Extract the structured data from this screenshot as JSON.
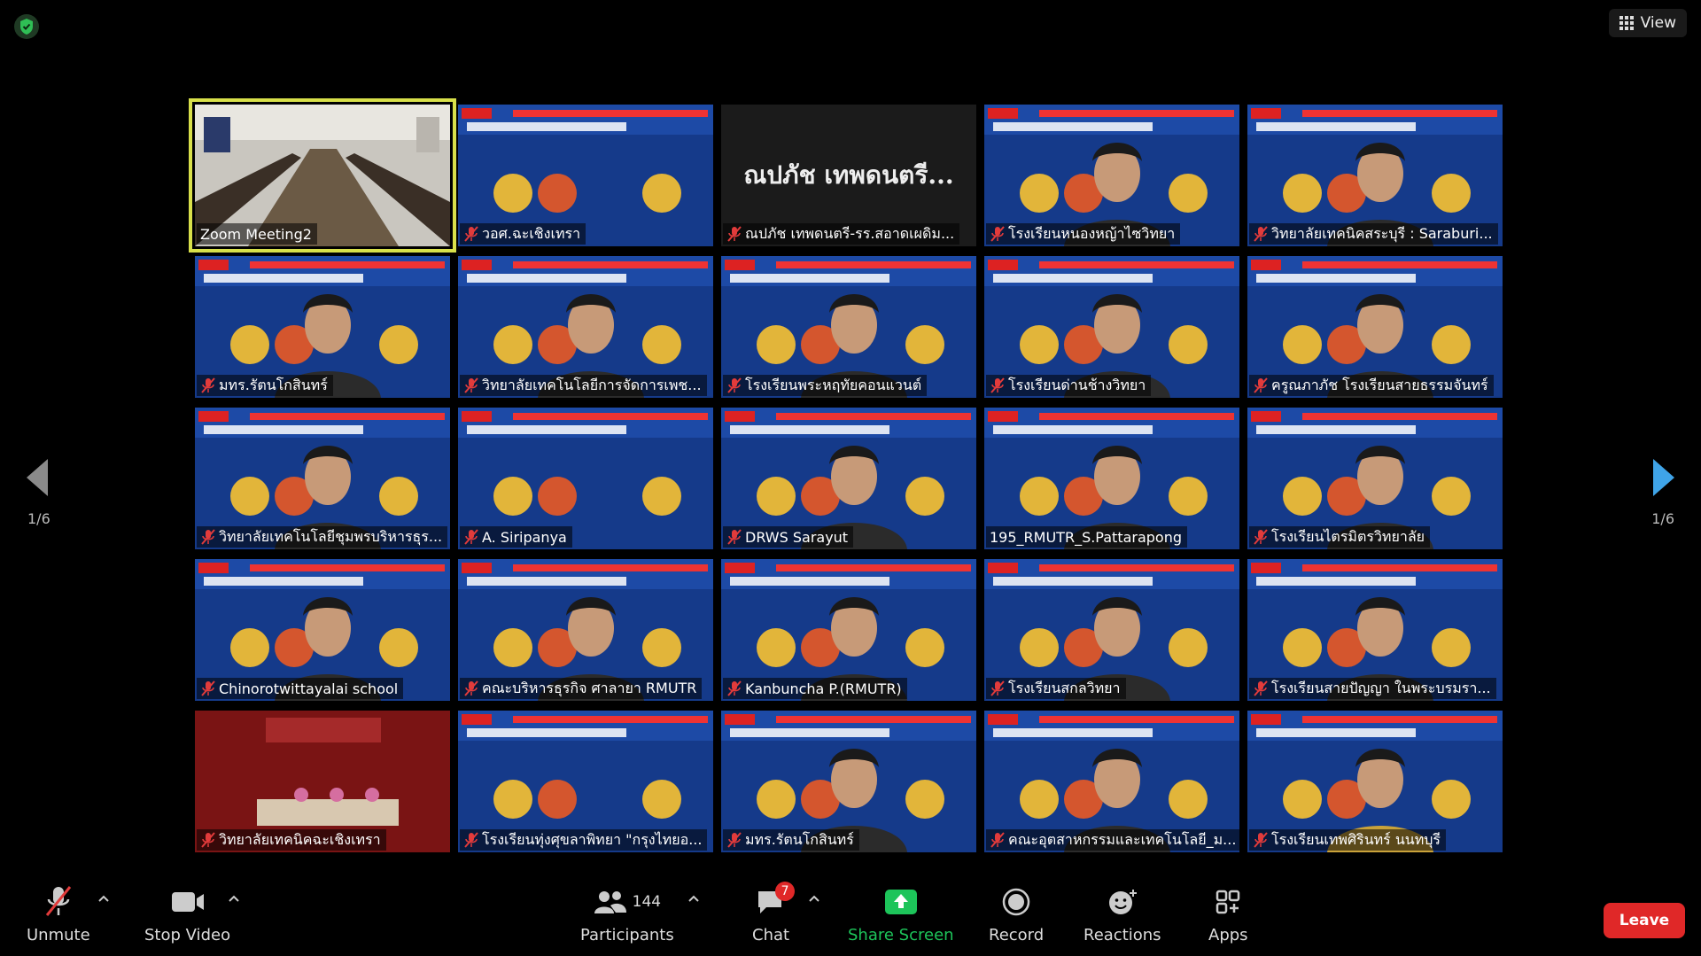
{
  "view_label": "View",
  "page_indicator": "1/6",
  "tiles": [
    {
      "name": "Zoom Meeting2",
      "muted": false,
      "active": true,
      "style": "room"
    },
    {
      "name": "วอศ.ฉะเชิงเทรา",
      "muted": true,
      "style": "slide"
    },
    {
      "name": "ณปภัช เทพดนตรี-รร.สอาดเผดิม...",
      "muted": true,
      "style": "nametile",
      "big_name": "ณปภัช เทพดนตรี..."
    },
    {
      "name": "โรงเรียนหนองหญ้าไซวิทยา",
      "muted": true,
      "style": "person"
    },
    {
      "name": "วิทยาลัยเทคนิคสระบุรี : Saraburi...",
      "muted": true,
      "style": "person"
    },
    {
      "name": "มทร.รัตนโกสินทร์",
      "muted": true,
      "style": "person"
    },
    {
      "name": "วิทยาลัยเทคโนโลยีการจัดการเพช...",
      "muted": true,
      "style": "person"
    },
    {
      "name": "โรงเรียนพระหฤทัยคอนแวนต์",
      "muted": true,
      "style": "person"
    },
    {
      "name": "โรงเรียนด่านช้างวิทยา",
      "muted": true,
      "style": "person"
    },
    {
      "name": "ครูณภาภัช โรงเรียนสายธรรมจันทร์",
      "muted": true,
      "style": "person"
    },
    {
      "name": "วิทยาลัยเทคโนโลยีชุมพรบริหารธุร...",
      "muted": true,
      "style": "person"
    },
    {
      "name": "A. Siripanya",
      "muted": true,
      "style": "slide"
    },
    {
      "name": "DRWS Sarayut",
      "muted": true,
      "style": "person"
    },
    {
      "name": "195_RMUTR_S.Pattarapong",
      "muted": false,
      "style": "person"
    },
    {
      "name": "โรงเรียนไตรมิตรวิทยาลัย",
      "muted": true,
      "style": "person"
    },
    {
      "name": "Chinorotwittayalai school",
      "muted": true,
      "style": "person"
    },
    {
      "name": "คณะบริหารธุรกิจ ศาลายา RMUTR",
      "muted": true,
      "style": "person"
    },
    {
      "name": "Kanbuncha P.(RMUTR)",
      "muted": true,
      "style": "person"
    },
    {
      "name": "โรงเรียนสกลวิทยา",
      "muted": true,
      "style": "person"
    },
    {
      "name": "โรงเรียนสายปัญญา ในพระบรมรา...",
      "muted": true,
      "style": "person"
    },
    {
      "name": "วิทยาลัยเทคนิคฉะเชิงเทรา",
      "muted": true,
      "style": "redroom"
    },
    {
      "name": "โรงเรียนทุ่งศุขลาพิทยา \"กรุงไทยอ...",
      "muted": true,
      "style": "slide"
    },
    {
      "name": "มทร.รัตนโกสินทร์",
      "muted": true,
      "style": "person"
    },
    {
      "name": "คณะอุตสาหกรรมและเทคโนโลยี_ม...",
      "muted": true,
      "style": "person"
    },
    {
      "name": "โรงเรียนเทพศิรินทร์ นนทบุรี",
      "muted": true,
      "style": "goldperson"
    }
  ],
  "toolbar": {
    "unmute": "Unmute",
    "stop_video": "Stop Video",
    "participants": "Participants",
    "participants_count": "144",
    "chat": "Chat",
    "chat_badge": "7",
    "share_screen": "Share Screen",
    "record": "Record",
    "reactions": "Reactions",
    "apps": "Apps",
    "leave": "Leave"
  },
  "colors": {
    "accent_green": "#1dc45a",
    "leave_red": "#e02828",
    "active_border": "#d8e04a",
    "mic_red": "#e23b3b"
  }
}
